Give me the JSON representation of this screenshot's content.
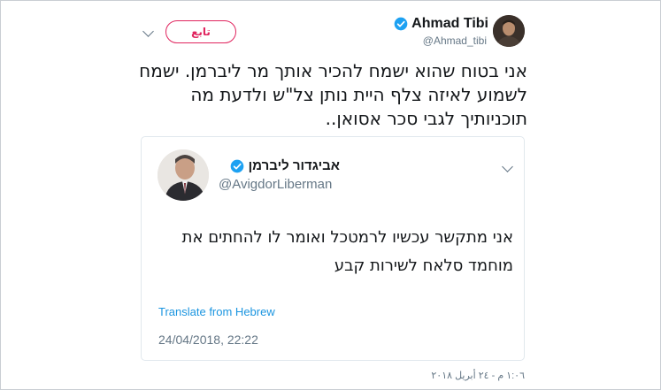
{
  "tweet": {
    "author_name": "Ahmad Tibi",
    "author_handle": "@Ahmad_tibi",
    "follow_label": "تابع",
    "text": "אני בטוח שהוא ישמח להכיר אותך מר ליברמן. ישמח לשמוע לאיזה צלף היית נותן צל\"ש ולדעת מה תוכניותיך לגבי סכר אסואן..",
    "timestamp": "١:٠٦ م - ٢٤ أبريل ٢٠١٨",
    "menu_icon": "chevron-down-icon",
    "verified_icon": "verified-badge-icon"
  },
  "quoted_tweet": {
    "author_name": "אביגדור ליברמן",
    "author_handle": "@AvigdorLiberman",
    "text": "אני מתקשר עכשיו לרמטכל ואומר לו להחתים את מוחמד סלאח לשירות קבע",
    "translate_label": "Translate from Hebrew",
    "timestamp": "24/04/2018, 22:22",
    "menu_icon": "chevron-down-icon",
    "verified_icon": "verified-badge-icon"
  },
  "colors": {
    "follow_accent": "#e0245e",
    "verified_blue": "#1da1f2",
    "link_blue": "#1b95e0",
    "secondary_text": "#657786",
    "border": "#e1e8ed"
  }
}
